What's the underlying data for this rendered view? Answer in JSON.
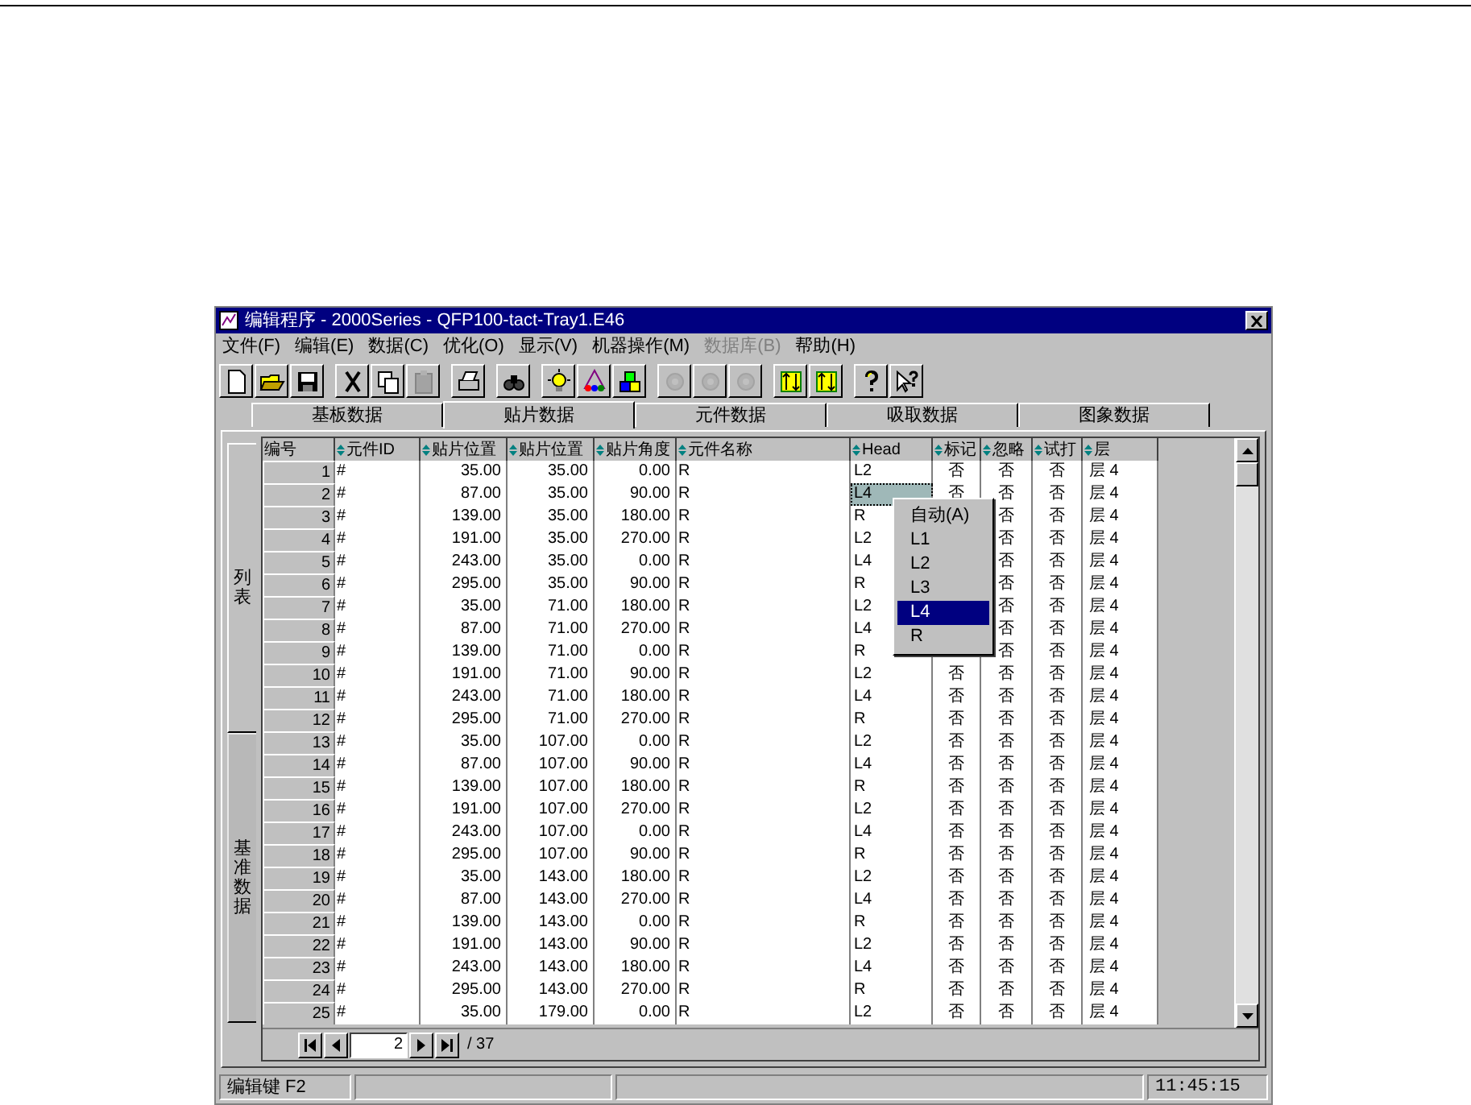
{
  "window": {
    "title": "编辑程序 - 2000Series - QFP100-tact-Tray1.E46"
  },
  "menu": [
    {
      "label": "文件(F)",
      "disabled": false
    },
    {
      "label": "编辑(E)",
      "disabled": false
    },
    {
      "label": "数据(C)",
      "disabled": false
    },
    {
      "label": "优化(O)",
      "disabled": false
    },
    {
      "label": "显示(V)",
      "disabled": false
    },
    {
      "label": "机器操作(M)",
      "disabled": false
    },
    {
      "label": "数据库(B)",
      "disabled": true
    },
    {
      "label": "帮助(H)",
      "disabled": false
    }
  ],
  "toolbar": [
    {
      "kind": "new",
      "disabled": false
    },
    {
      "kind": "open",
      "disabled": false
    },
    {
      "kind": "save",
      "disabled": false
    },
    {
      "kind": "sep"
    },
    {
      "kind": "cut",
      "disabled": false
    },
    {
      "kind": "copy",
      "disabled": false
    },
    {
      "kind": "paste",
      "disabled": true
    },
    {
      "kind": "sep"
    },
    {
      "kind": "print",
      "disabled": false
    },
    {
      "kind": "sep"
    },
    {
      "kind": "find",
      "disabled": false
    },
    {
      "kind": "sep"
    },
    {
      "kind": "bulb",
      "disabled": false
    },
    {
      "kind": "shapes",
      "disabled": false
    },
    {
      "kind": "blocks",
      "disabled": false
    },
    {
      "kind": "sep"
    },
    {
      "kind": "tool",
      "disabled": true
    },
    {
      "kind": "tool",
      "disabled": true
    },
    {
      "kind": "tool",
      "disabled": true
    },
    {
      "kind": "sep"
    },
    {
      "kind": "swap",
      "disabled": false
    },
    {
      "kind": "swap",
      "disabled": false
    },
    {
      "kind": "sep"
    },
    {
      "kind": "help",
      "disabled": false
    },
    {
      "kind": "pointer_help",
      "disabled": false
    }
  ],
  "tabs": [
    {
      "label": "基板数据",
      "selected": false
    },
    {
      "label": "贴片数据",
      "selected": true
    },
    {
      "label": "元件数据",
      "selected": false
    },
    {
      "label": "吸取数据",
      "selected": false
    },
    {
      "label": "图象数据",
      "selected": false
    }
  ],
  "side_tabs": [
    {
      "label": "列表",
      "selected": true
    },
    {
      "label": "基准数据",
      "selected": false
    }
  ],
  "table": {
    "columns": [
      "编号",
      "元件ID",
      "贴片位置",
      "贴片位置",
      "贴片角度",
      "元件名称",
      "Head",
      "标记",
      "忽略",
      "试打",
      "层"
    ],
    "rows": [
      {
        "cells": [
          "1",
          "#",
          "35.00",
          "35.00",
          "0.00",
          "R",
          "L2",
          "否",
          "否",
          "否",
          "层 4"
        ],
        "selected": false
      },
      {
        "cells": [
          "2",
          "#",
          "87.00",
          "35.00",
          "90.00",
          "R",
          "L4",
          "否",
          "否",
          "否",
          "层 4"
        ],
        "selected": true
      },
      {
        "cells": [
          "3",
          "#",
          "139.00",
          "35.00",
          "180.00",
          "R",
          "R",
          null,
          "否",
          "否",
          "层 4"
        ],
        "selected": false
      },
      {
        "cells": [
          "4",
          "#",
          "191.00",
          "35.00",
          "270.00",
          "R",
          "L2",
          null,
          "否",
          "否",
          "层 4"
        ],
        "selected": false
      },
      {
        "cells": [
          "5",
          "#",
          "243.00",
          "35.00",
          "0.00",
          "R",
          "L4",
          null,
          "否",
          "否",
          "层 4"
        ],
        "selected": false
      },
      {
        "cells": [
          "6",
          "#",
          "295.00",
          "35.00",
          "90.00",
          "R",
          "R",
          null,
          "否",
          "否",
          "层 4"
        ],
        "selected": false
      },
      {
        "cells": [
          "7",
          "#",
          "35.00",
          "71.00",
          "180.00",
          "R",
          "L2",
          null,
          "否",
          "否",
          "层 4"
        ],
        "selected": false
      },
      {
        "cells": [
          "8",
          "#",
          "87.00",
          "71.00",
          "270.00",
          "R",
          "L4",
          null,
          "否",
          "否",
          "层 4"
        ],
        "selected": false
      },
      {
        "cells": [
          "9",
          "#",
          "139.00",
          "71.00",
          "0.00",
          "R",
          "R",
          null,
          "否",
          "否",
          "层 4"
        ],
        "selected": false
      },
      {
        "cells": [
          "10",
          "#",
          "191.00",
          "71.00",
          "90.00",
          "R",
          "L2",
          "否",
          "否",
          "否",
          "层 4"
        ],
        "selected": false
      },
      {
        "cells": [
          "11",
          "#",
          "243.00",
          "71.00",
          "180.00",
          "R",
          "L4",
          "否",
          "否",
          "否",
          "层 4"
        ],
        "selected": false
      },
      {
        "cells": [
          "12",
          "#",
          "295.00",
          "71.00",
          "270.00",
          "R",
          "R",
          "否",
          "否",
          "否",
          "层 4"
        ],
        "selected": false
      },
      {
        "cells": [
          "13",
          "#",
          "35.00",
          "107.00",
          "0.00",
          "R",
          "L2",
          "否",
          "否",
          "否",
          "层 4"
        ],
        "selected": false
      },
      {
        "cells": [
          "14",
          "#",
          "87.00",
          "107.00",
          "90.00",
          "R",
          "L4",
          "否",
          "否",
          "否",
          "层 4"
        ],
        "selected": false
      },
      {
        "cells": [
          "15",
          "#",
          "139.00",
          "107.00",
          "180.00",
          "R",
          "R",
          "否",
          "否",
          "否",
          "层 4"
        ],
        "selected": false
      },
      {
        "cells": [
          "16",
          "#",
          "191.00",
          "107.00",
          "270.00",
          "R",
          "L2",
          "否",
          "否",
          "否",
          "层 4"
        ],
        "selected": false
      },
      {
        "cells": [
          "17",
          "#",
          "243.00",
          "107.00",
          "0.00",
          "R",
          "L4",
          "否",
          "否",
          "否",
          "层 4"
        ],
        "selected": false
      },
      {
        "cells": [
          "18",
          "#",
          "295.00",
          "107.00",
          "90.00",
          "R",
          "R",
          "否",
          "否",
          "否",
          "层 4"
        ],
        "selected": false
      },
      {
        "cells": [
          "19",
          "#",
          "35.00",
          "143.00",
          "180.00",
          "R",
          "L2",
          "否",
          "否",
          "否",
          "层 4"
        ],
        "selected": false
      },
      {
        "cells": [
          "20",
          "#",
          "87.00",
          "143.00",
          "270.00",
          "R",
          "L4",
          "否",
          "否",
          "否",
          "层 4"
        ],
        "selected": false
      },
      {
        "cells": [
          "21",
          "#",
          "139.00",
          "143.00",
          "0.00",
          "R",
          "R",
          "否",
          "否",
          "否",
          "层 4"
        ],
        "selected": false
      },
      {
        "cells": [
          "22",
          "#",
          "191.00",
          "143.00",
          "90.00",
          "R",
          "L2",
          "否",
          "否",
          "否",
          "层 4"
        ],
        "selected": false
      },
      {
        "cells": [
          "23",
          "#",
          "243.00",
          "143.00",
          "180.00",
          "R",
          "L4",
          "否",
          "否",
          "否",
          "层 4"
        ],
        "selected": false
      },
      {
        "cells": [
          "24",
          "#",
          "295.00",
          "143.00",
          "270.00",
          "R",
          "R",
          "否",
          "否",
          "否",
          "层 4"
        ],
        "selected": false
      },
      {
        "cells": [
          "25",
          "#",
          "35.00",
          "179.00",
          "0.00",
          "R",
          "L2",
          "否",
          "否",
          "否",
          "层 4"
        ],
        "selected": false
      }
    ]
  },
  "context_menu": [
    {
      "label": "自动(A)",
      "selected": false
    },
    {
      "label": "L1",
      "selected": false
    },
    {
      "label": "L2",
      "selected": false
    },
    {
      "label": "L3",
      "selected": false
    },
    {
      "label": "L4",
      "selected": true
    },
    {
      "label": "R",
      "selected": false
    }
  ],
  "navigator": {
    "page": "2",
    "total": "/ 37"
  },
  "status_bar": {
    "hint": "编辑键 F2",
    "time": "11:45:15"
  }
}
